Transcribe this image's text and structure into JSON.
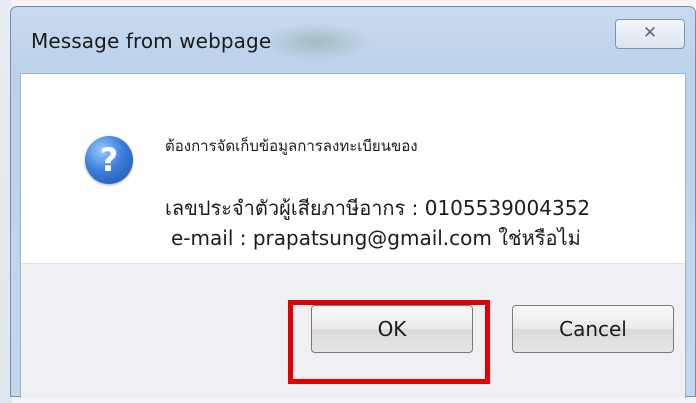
{
  "dialog": {
    "title": "Message from webpage",
    "close_glyph": "✕",
    "icon": "question-icon",
    "question_glyph": "?",
    "message_line1": "ต้องการจัดเก็บข้อมูลการลงทะเบียนของ",
    "message_line2": "เลขประจำตัวผู้เสียภาษีอากร : 0105539004352",
    "message_line3": "e-mail : prapatsung@gmail.com ใช่หรือไม่",
    "ok_label": "OK",
    "cancel_label": "Cancel"
  },
  "colors": {
    "highlight": "#e40000",
    "titlebar": "#c9daee"
  }
}
